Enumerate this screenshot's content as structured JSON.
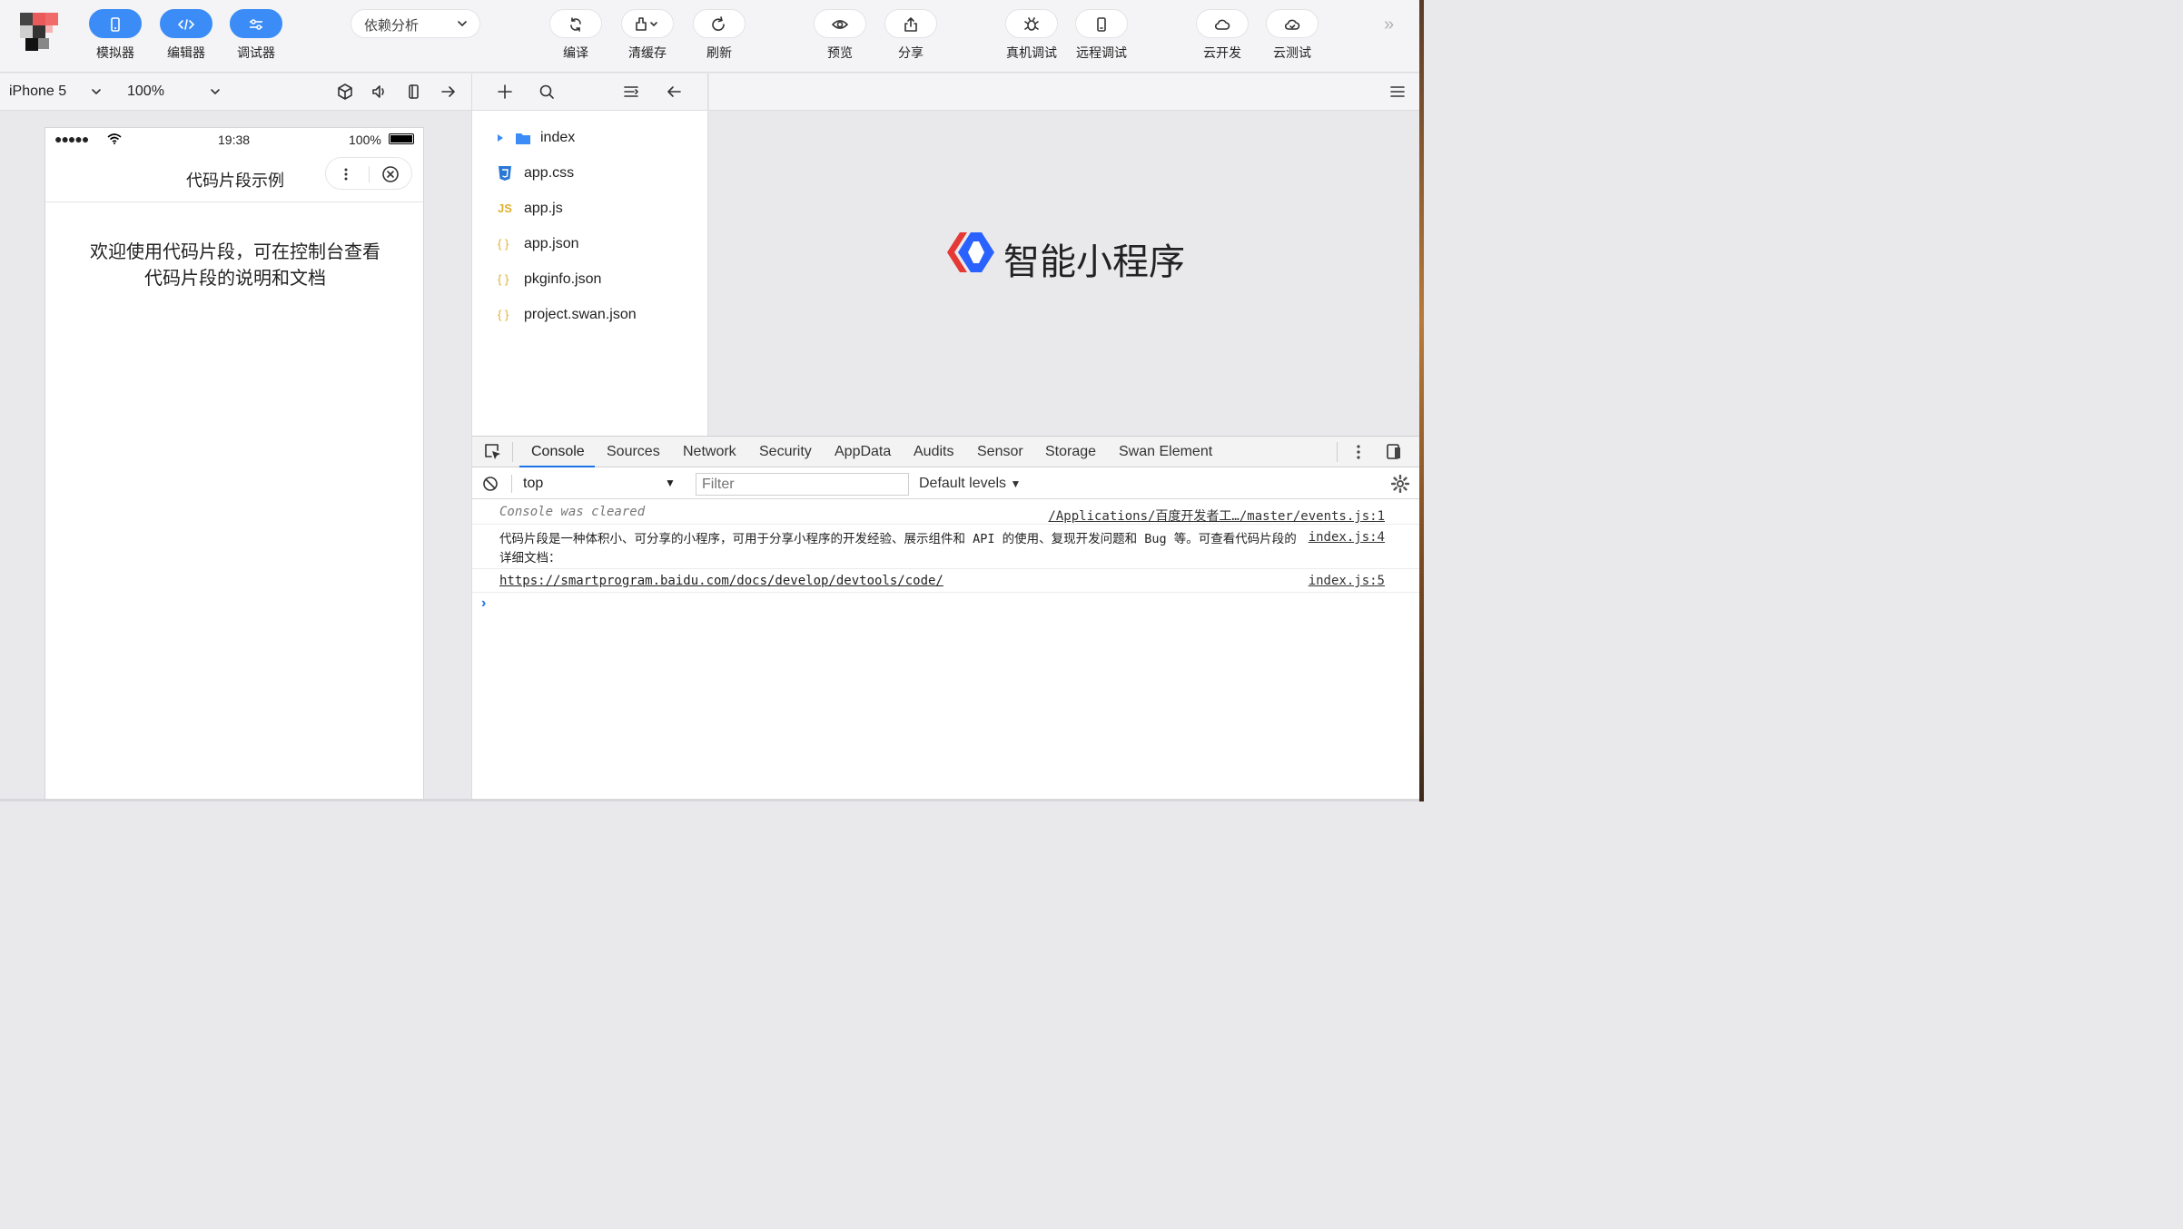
{
  "toolbar": {
    "simulator_label": "模拟器",
    "editor_label": "编辑器",
    "debugger_label": "调试器",
    "dependency_select": "依赖分析",
    "compile_label": "编译",
    "clear_cache_label": "清缓存",
    "refresh_label": "刷新",
    "preview_label": "预览",
    "share_label": "分享",
    "real_device_debug_label": "真机调试",
    "remote_debug_label": "远程调试",
    "cloud_dev_label": "云开发",
    "cloud_test_label": "云测试",
    "accent_color": "#3b8cf6"
  },
  "simulator": {
    "device": "iPhone 5",
    "zoom": "100%",
    "status_time": "19:38",
    "status_battery": "100%",
    "status_dots": "●●●●●",
    "page_title": "代码片段示例",
    "content_line1": "欢迎使用代码片段，可在控制台查看",
    "content_line2": "代码片段的说明和文档"
  },
  "file_tree": {
    "items": [
      {
        "name": "index",
        "type": "folder"
      },
      {
        "name": "app.css",
        "type": "css"
      },
      {
        "name": "app.js",
        "type": "js"
      },
      {
        "name": "app.json",
        "type": "json"
      },
      {
        "name": "pkginfo.json",
        "type": "json"
      },
      {
        "name": "project.swan.json",
        "type": "json"
      }
    ],
    "js_badge": "JS",
    "json_badge": "{ }"
  },
  "editor": {
    "brand_text": "智能小程序"
  },
  "devtools": {
    "tabs": [
      "Console",
      "Sources",
      "Network",
      "Security",
      "AppData",
      "Audits",
      "Sensor",
      "Storage",
      "Swan Element"
    ],
    "context": "top",
    "filter_placeholder": "Filter",
    "levels": "Default levels",
    "console": [
      {
        "message": "Console was cleared",
        "source": "/Applications/百度开发者工…/master/events.js:1"
      },
      {
        "message": "代码片段是一种体积小、可分享的小程序，可用于分享小程序的开发经验、展示组件和 API 的使用、复现开发问题和 Bug 等。可查看代码片段的详细文档：",
        "source": "index.js:4"
      },
      {
        "message": "https://smartprogram.baidu.com/docs/develop/devtools/code/",
        "source": "index.js:5"
      }
    ],
    "prompt": "›"
  }
}
